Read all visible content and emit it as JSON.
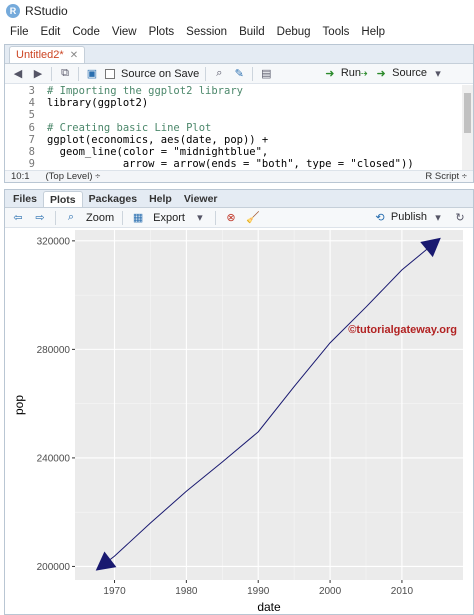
{
  "window": {
    "title": "RStudio",
    "icon": "R"
  },
  "menu": [
    "File",
    "Edit",
    "Code",
    "View",
    "Plots",
    "Session",
    "Build",
    "Debug",
    "Tools",
    "Help"
  ],
  "editor": {
    "tab_label": "Untitled2*",
    "source_on_save_label": "Source on Save",
    "run_label": "Run",
    "source_label": "Source",
    "line_numbers": [
      "3",
      "4",
      "5",
      "6",
      "7",
      "8",
      "9"
    ],
    "code_lines": [
      "# Importing the ggplot2 library",
      "library(ggplot2)",
      "",
      "# Creating basic Line Plot",
      "ggplot(economics, aes(date, pop)) +",
      "  geom_line(color = \"midnightblue\",",
      "            arrow = arrow(ends = \"both\", type = \"closed\"))"
    ],
    "status_position": "10:1",
    "status_scope": "(Top Level) ÷",
    "status_type": "R Script ÷"
  },
  "lower_pane": {
    "tabs": [
      "Files",
      "Plots",
      "Packages",
      "Help",
      "Viewer"
    ],
    "active_tab": "Plots",
    "zoom_label": "Zoom",
    "export_label": "Export",
    "publish_label": "Publish"
  },
  "chart_data": {
    "type": "line",
    "xlabel": "date",
    "ylabel": "pop",
    "x_ticks": [
      "1970",
      "1980",
      "1990",
      "2000",
      "2010"
    ],
    "y_ticks": [
      "200000",
      "240000",
      "280000",
      "320000"
    ],
    "xlim": [
      1964.5,
      2018.5
    ],
    "ylim": [
      195000,
      324000
    ],
    "line_color": "#191970",
    "arrows": "both",
    "grid": true,
    "background": "#ebebeb",
    "watermark": "©tutorialgateway.org",
    "watermark_color": "#b22222",
    "x": [
      1967.5,
      1970,
      1975,
      1980,
      1985,
      1990,
      1995,
      2000,
      2005,
      2010,
      2015.3
    ],
    "y": [
      198700,
      203800,
      216000,
      227700,
      238500,
      249600,
      266300,
      282400,
      295600,
      309300,
      320900
    ]
  }
}
